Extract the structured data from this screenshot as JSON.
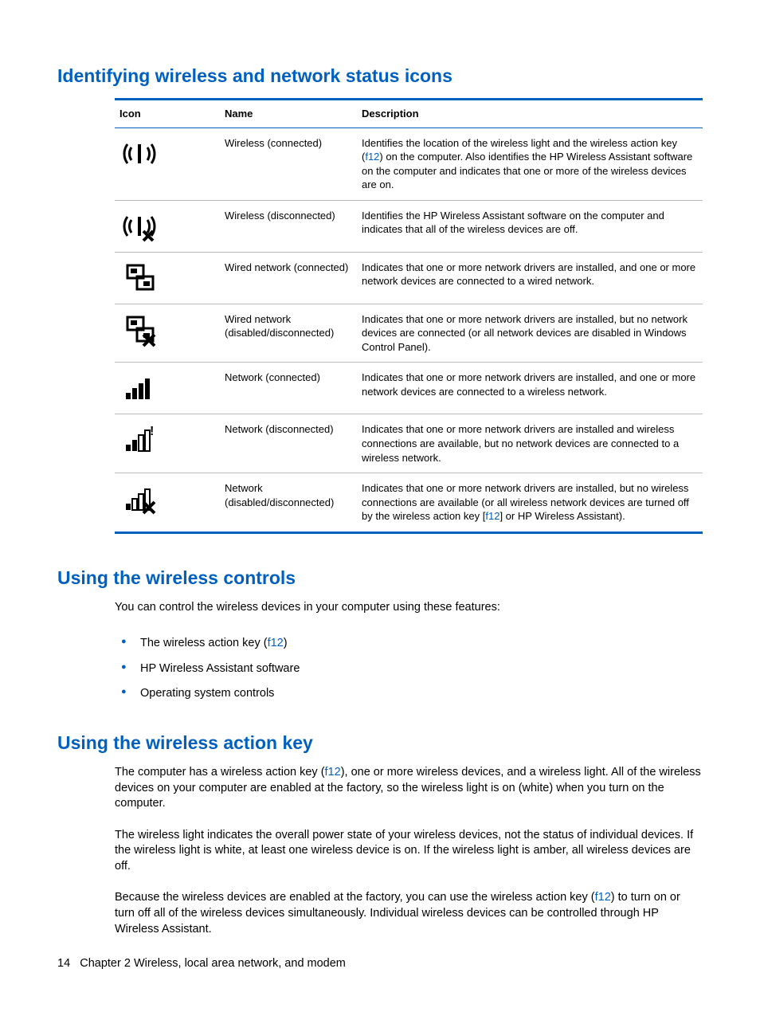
{
  "section1": {
    "heading": "Identifying wireless and network status icons",
    "headers": {
      "icon": "Icon",
      "name": "Name",
      "desc": "Description"
    },
    "rows": [
      {
        "icon": "wireless-on",
        "name": "Wireless (connected)",
        "desc_pre": "Identifies the location of the wireless light and the wireless action key (",
        "key": "f12",
        "desc_post": ") on the computer. Also identifies the HP Wireless Assistant software on the computer and indicates that one or more of the wireless devices are on."
      },
      {
        "icon": "wireless-off",
        "name": "Wireless (disconnected)",
        "desc_pre": "Identifies the HP Wireless Assistant software on the computer and indicates that all of the wireless devices are off.",
        "key": "",
        "desc_post": ""
      },
      {
        "icon": "wired-on",
        "name": "Wired network (connected)",
        "desc_pre": "Indicates that one or more network drivers are installed, and one or more network devices are connected to a wired network.",
        "key": "",
        "desc_post": ""
      },
      {
        "icon": "wired-off",
        "name": "Wired network (disabled/disconnected)",
        "desc_pre": "Indicates that one or more network drivers are installed, but no network devices are connected (or all network devices are disabled in Windows Control Panel).",
        "key": "",
        "desc_post": ""
      },
      {
        "icon": "net-on",
        "name": "Network (connected)",
        "desc_pre": "Indicates that one or more network drivers are installed, and one or more network devices are connected to a wireless network.",
        "key": "",
        "desc_post": ""
      },
      {
        "icon": "net-disc",
        "name": "Network (disconnected)",
        "desc_pre": "Indicates that one or more network drivers are installed and wireless connections are available, but no network devices are connected to a wireless network.",
        "key": "",
        "desc_post": ""
      },
      {
        "icon": "net-off",
        "name": "Network (disabled/disconnected)",
        "desc_pre": "Indicates that one or more network drivers are installed, but no wireless connections are available (or all wireless network devices are turned off by the wireless action key [",
        "key": "f12",
        "desc_post": "] or HP Wireless Assistant)."
      }
    ]
  },
  "section2": {
    "heading": "Using the wireless controls",
    "intro": "You can control the wireless devices in your computer using these features:",
    "bullets": [
      {
        "pre": "The wireless action key (",
        "key": "f12",
        "post": ")"
      },
      {
        "pre": "HP Wireless Assistant software",
        "key": "",
        "post": ""
      },
      {
        "pre": "Operating system controls",
        "key": "",
        "post": ""
      }
    ]
  },
  "section3": {
    "heading": "Using the wireless action key",
    "p1": {
      "pre": "The computer has a wireless action key (",
      "key": "f12",
      "post": "), one or more wireless devices, and a wireless light. All of the wireless devices on your computer are enabled at the factory, so the wireless light is on (white) when you turn on the computer."
    },
    "p2": "The wireless light indicates the overall power state of your wireless devices, not the status of individual devices. If the wireless light is white, at least one wireless device is on. If the wireless light is amber, all wireless devices are off.",
    "p3": {
      "pre": "Because the wireless devices are enabled at the factory, you can use the wireless action key (",
      "key": "f12",
      "post": ") to turn on or turn off all of the wireless devices simultaneously. Individual wireless devices can be controlled through HP Wireless Assistant."
    }
  },
  "footer": {
    "page": "14",
    "chapter": "Chapter 2   Wireless, local area network, and modem"
  }
}
